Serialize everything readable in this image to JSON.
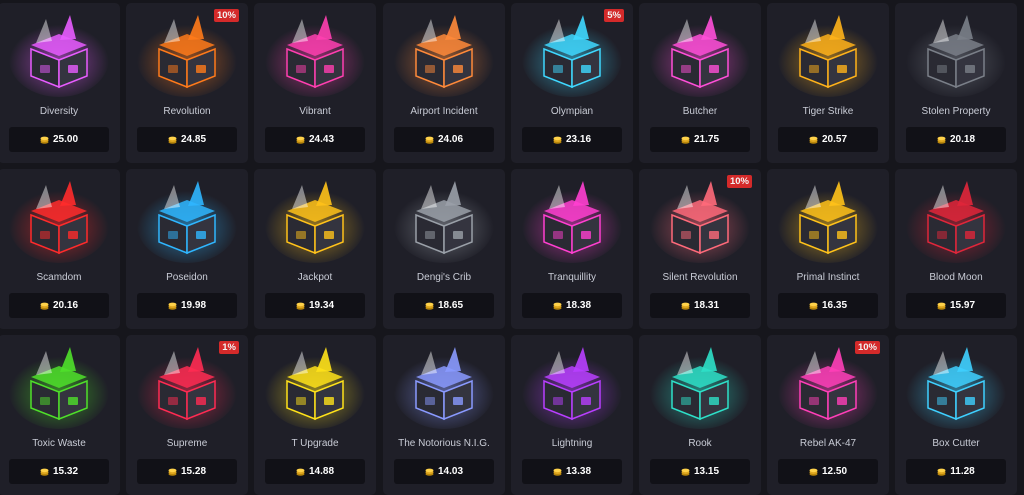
{
  "icons": {
    "coin": "gold-coin-stack-icon",
    "case_art": "case-chest-icon"
  },
  "cases": [
    {
      "name": "Diversity",
      "price": "25.00",
      "badge": "",
      "color": "#e85cff"
    },
    {
      "name": "Revolution",
      "price": "24.85",
      "badge": "10%",
      "color": "#ff7a1a"
    },
    {
      "name": "Vibrant",
      "price": "24.43",
      "badge": "",
      "color": "#ff3fb0"
    },
    {
      "name": "Airport Incident",
      "price": "24.06",
      "badge": "",
      "color": "#ff8a3a"
    },
    {
      "name": "Olympian",
      "price": "23.16",
      "badge": "5%",
      "color": "#3fd8ff"
    },
    {
      "name": "Butcher",
      "price": "21.75",
      "badge": "",
      "color": "#ff4fd8"
    },
    {
      "name": "Tiger Strike",
      "price": "20.57",
      "badge": "",
      "color": "#ffb21a"
    },
    {
      "name": "Stolen Property",
      "price": "20.18",
      "badge": "",
      "color": "#7a7f88"
    },
    {
      "name": "Scamdom",
      "price": "20.16",
      "badge": "",
      "color": "#ff2b2b"
    },
    {
      "name": "Poseidon",
      "price": "19.98",
      "badge": "",
      "color": "#2fb6ff"
    },
    {
      "name": "Jackpot",
      "price": "19.34",
      "badge": "",
      "color": "#ffc21a"
    },
    {
      "name": "Dengi's Crib",
      "price": "18.65",
      "badge": "",
      "color": "#9aa0a8"
    },
    {
      "name": "Tranquillity",
      "price": "18.38",
      "badge": "",
      "color": "#ff3fd0"
    },
    {
      "name": "Silent Revolution",
      "price": "18.31",
      "badge": "10%",
      "color": "#ff6a7a"
    },
    {
      "name": "Primal Instinct",
      "price": "16.35",
      "badge": "",
      "color": "#ffc21a"
    },
    {
      "name": "Blood Moon",
      "price": "15.97",
      "badge": "",
      "color": "#e0263a"
    },
    {
      "name": "Toxic Waste",
      "price": "15.32",
      "badge": "",
      "color": "#4fe02a"
    },
    {
      "name": "Supreme",
      "price": "15.28",
      "badge": "1%",
      "color": "#ff2b52"
    },
    {
      "name": "T Upgrade",
      "price": "14.88",
      "badge": "",
      "color": "#ffe21a"
    },
    {
      "name": "The Notorious N.I.G.",
      "price": "14.03",
      "badge": "",
      "color": "#8a9aff"
    },
    {
      "name": "Lightning",
      "price": "13.38",
      "badge": "",
      "color": "#b83fff"
    },
    {
      "name": "Rook",
      "price": "13.15",
      "badge": "",
      "color": "#2ee0c8"
    },
    {
      "name": "Rebel AK-47",
      "price": "12.50",
      "badge": "10%",
      "color": "#ff3fb8"
    },
    {
      "name": "Box Cutter",
      "price": "11.28",
      "badge": "",
      "color": "#3fd0ff"
    }
  ]
}
